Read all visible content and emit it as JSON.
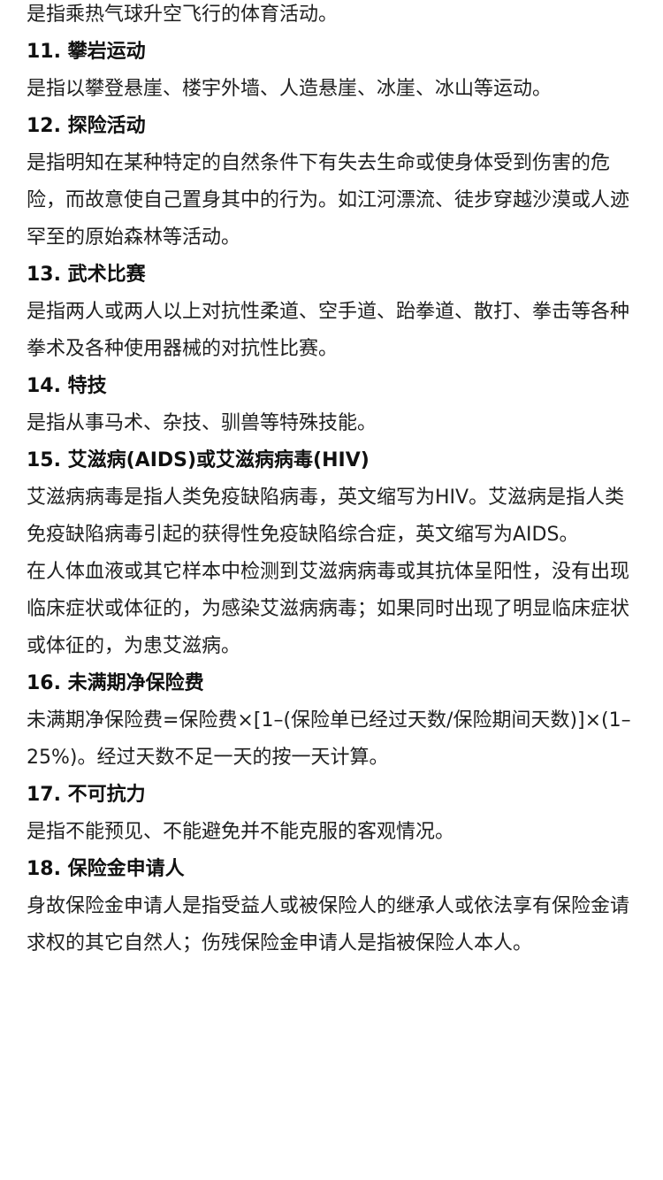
{
  "intro": "是指乘热气球升空飞行的体育活动。",
  "sections": [
    {
      "heading": "11. 攀岩运动",
      "paragraphs": [
        "是指以攀登悬崖、楼宇外墙、人造悬崖、冰崖、冰山等运动。"
      ]
    },
    {
      "heading": "12. 探险活动",
      "paragraphs": [
        "是指明知在某种特定的自然条件下有失去生命或使身体受到伤害的危险，而故意使自己置身其中的行为。如江河漂流、徒步穿越沙漠或人迹罕至的原始森林等活动。"
      ]
    },
    {
      "heading": "13. 武术比赛",
      "paragraphs": [
        "是指两人或两人以上对抗性柔道、空手道、跆拳道、散打、拳击等各种拳术及各种使用器械的对抗性比赛。"
      ]
    },
    {
      "heading": "14. 特技",
      "paragraphs": [
        "是指从事马术、杂技、驯兽等特殊技能。"
      ]
    },
    {
      "heading": "15. 艾滋病(AIDS)或艾滋病病毒(HIV)",
      "paragraphs": [
        "艾滋病病毒是指人类免疫缺陷病毒，英文缩写为HIV。艾滋病是指人类免疫缺陷病毒引起的获得性免疫缺陷综合症，英文缩写为AIDS。",
        "在人体血液或其它样本中检测到艾滋病病毒或其抗体呈阳性，没有出现临床症状或体征的，为感染艾滋病病毒；如果同时出现了明显临床症状或体征的，为患艾滋病。"
      ]
    },
    {
      "heading": "16. 未满期净保险费",
      "paragraphs": [
        "未满期净保险费=保险费×[1–(保险单已经过天数/保险期间天数)]×(1–25%)。经过天数不足一天的按一天计算。"
      ]
    },
    {
      "heading": "17. 不可抗力",
      "paragraphs": [
        "是指不能预见、不能避免并不能克服的客观情况。"
      ]
    },
    {
      "heading": "18. 保险金申请人",
      "paragraphs": [
        "身故保险金申请人是指受益人或被保险人的继承人或依法享有保险金请求权的其它自然人；伤残保险金申请人是指被保险人本人。"
      ]
    }
  ]
}
